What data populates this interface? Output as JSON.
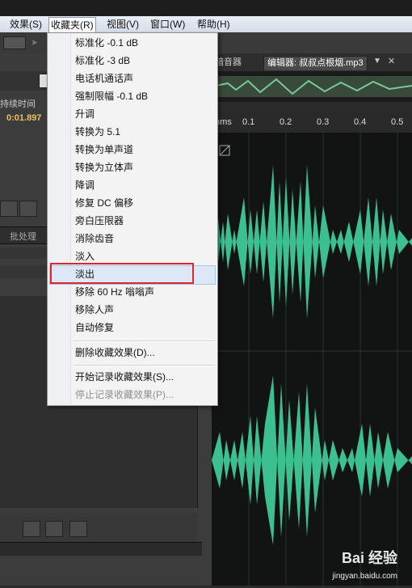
{
  "menubar": {
    "items": [
      "效果(S)",
      "收藏夹(R)",
      "视图(V)",
      "窗口(W)",
      "帮助(H)"
    ]
  },
  "editor": {
    "tab_partial": "暗音器",
    "tab_active": "编辑器: 叔叔点根烟.mp3",
    "ruler_unit": "hms",
    "ruler_ticks": [
      "0.1",
      "0.2",
      "0.3",
      "0.4",
      "0.5"
    ]
  },
  "left_panel": {
    "duration_label": "持续时间",
    "duration_value": "0:01.897",
    "batch_tab": "批处理",
    "fragment": ":)"
  },
  "favorites_menu": {
    "items": [
      "标准化 -0.1 dB",
      "标准化 -3 dB",
      "电话机通话声",
      "强制限幅 -0.1 dB",
      "升调",
      "转换为 5.1",
      "转换为单声道",
      "转换为立体声",
      "降调",
      "修复 DC 偏移",
      "旁白压限器",
      "消除齿音",
      "淡入",
      "淡出",
      "移除 60 Hz 嗡嗡声",
      "移除人声",
      "自动修复"
    ],
    "highlighted": "淡出",
    "delete_item": "删除收藏效果(D)...",
    "start_record": "开始记录收藏效果(S)...",
    "stop_record": "停止记录收藏效果(P)..."
  },
  "watermark": {
    "brand": "Bai 经验",
    "url": "jingyan.baidu.com"
  },
  "colors": {
    "waveform": "#3fc996",
    "highlight_box": "#e0262a"
  }
}
